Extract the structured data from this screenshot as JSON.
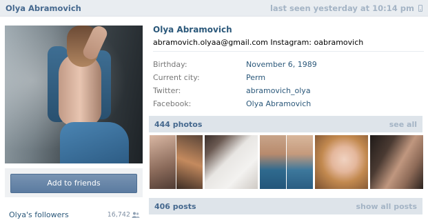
{
  "header": {
    "name": "Olya Abramovich",
    "last_seen": "last seen yesterday at 10:14 pm"
  },
  "profile": {
    "name": "Olya Abramovich",
    "status": "abramovich.olyaa@gmail.com Instagram: oabramovich",
    "info": [
      {
        "label": "Birthday:",
        "value": "November 6, 1989"
      },
      {
        "label": "Current city:",
        "value": "Perm"
      },
      {
        "label": "Twitter:",
        "value": "abramovich_olya"
      },
      {
        "label": "Facebook:",
        "value": "Olya Abramovich"
      }
    ]
  },
  "actions": {
    "add_to_friends": "Add to friends"
  },
  "followers": {
    "label": "Olya's followers",
    "count": "16,742"
  },
  "photos_section": {
    "title": "444 photos",
    "see_all": "see all"
  },
  "posts_section": {
    "title": "406 posts",
    "show_all": "show all posts"
  },
  "colors": {
    "link": "#2b587a",
    "header_bg": "#e9edf1",
    "section_bg": "#dee4ea",
    "button": "#5b7ba0",
    "muted": "#a4b4c5"
  }
}
